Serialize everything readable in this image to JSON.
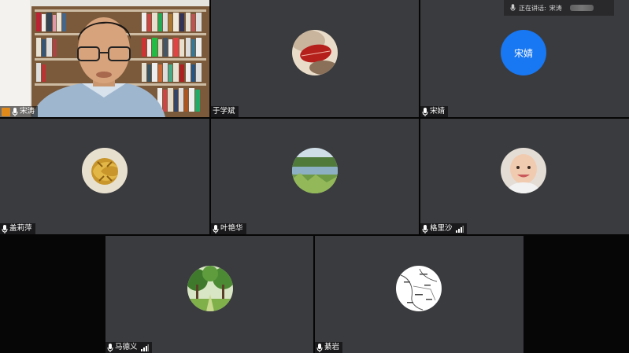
{
  "speaking_indicator": {
    "prefix": "正在讲话:",
    "speaker": "宋涛"
  },
  "participants": [
    {
      "name": "宋涛",
      "host": true,
      "video": true
    },
    {
      "name": "于学斌",
      "avatar": "red-leaf-photo"
    },
    {
      "name": "宋婧",
      "avatar_text": "宋婧"
    },
    {
      "name": "盖莉萍",
      "avatar": "gold-ornament-photo"
    },
    {
      "name": "叶艳华",
      "avatar": "lake-photo"
    },
    {
      "name": "格里沙",
      "avatar": "baby-photo",
      "signal": true
    },
    {
      "name": "马德义",
      "avatar": "forest-photo",
      "signal": true
    },
    {
      "name": "綦岩",
      "avatar": "map-sketch"
    }
  ],
  "colors": {
    "tile_bg": "#3a3b3e",
    "active_border": "#3fb54d",
    "avatar_blue": "#1877f2",
    "host_badge": "#e08a1c"
  }
}
